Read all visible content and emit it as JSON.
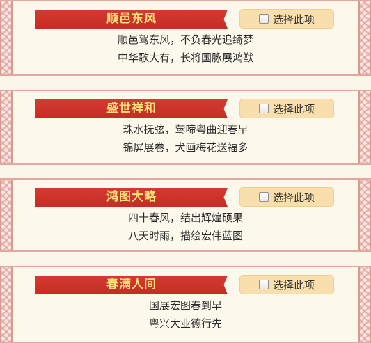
{
  "items": [
    {
      "title": "顺邑东风",
      "select_label": "选择此项",
      "checked": false,
      "lines": [
        "顺邑驾东风，不负春光追绮梦",
        "中华歌大有，长将国脉展鸿猷"
      ]
    },
    {
      "title": "盛世祥和",
      "select_label": "选择此项",
      "checked": false,
      "lines": [
        "珠水抚弦，莺啼粤曲迎春早",
        "锦屏展卷，犬画梅花送福多"
      ]
    },
    {
      "title": "鸿图大略",
      "select_label": "选择此项",
      "checked": false,
      "lines": [
        "四十春风，结出辉煌硕果",
        "八天时雨，描绘宏伟蓝图"
      ]
    },
    {
      "title": "春满人间",
      "select_label": "选择此项",
      "checked": false,
      "lines": [
        "国展宏图春到早",
        "粤兴大业德行先"
      ]
    }
  ],
  "colors": {
    "title_bar": "#c92f27",
    "title_text": "#ffe27a",
    "select_button_bg": "#f9dfae",
    "border_pink": "#e3a7a0"
  }
}
